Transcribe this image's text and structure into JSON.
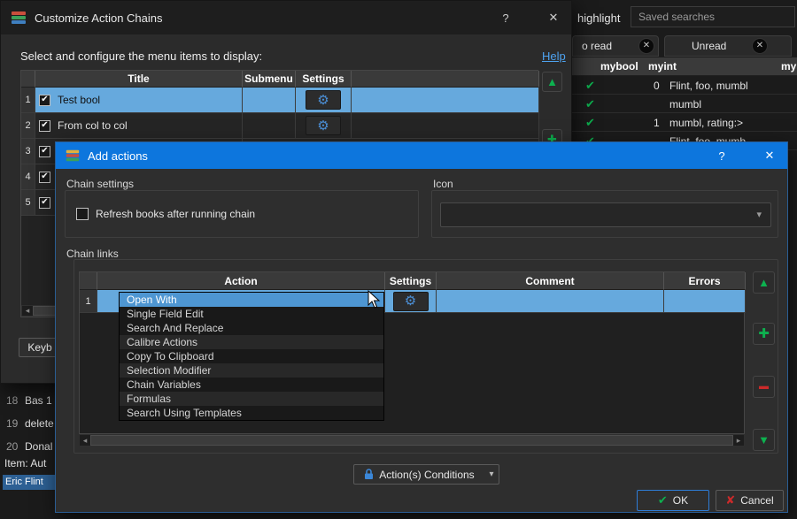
{
  "icons": {
    "check": "✔",
    "cross": "✘",
    "close": "✕",
    "help": "?",
    "up": "▲",
    "down": "▼",
    "plus": "✚",
    "minus": "▬",
    "gear": "⚙",
    "dropdown": "▾",
    "left": "◂",
    "right": "▸"
  },
  "colors": {
    "titlebar_blue": "#0d76dd",
    "selection_blue": "#66a9dd",
    "popup_highlight": "#4e96d2",
    "green": "#0db14f",
    "red": "#cc2a2a",
    "gear_blue": "#4b8fd6",
    "link_blue": "#4ea3f0",
    "item_chip_blue": "#2d6094"
  },
  "main_window": {
    "highlight_label": "highlight",
    "saved_searches_value": "Saved searches",
    "tabs": [
      {
        "label": "o read"
      },
      {
        "label": "Unread"
      }
    ],
    "book_table": {
      "columns": [
        "mybool",
        "myint",
        "my"
      ],
      "rows": [
        {
          "mybool_checked": true,
          "myint": "0",
          "my": "Flint, foo, mumbl"
        },
        {
          "mybool_checked": true,
          "myint": "",
          "my": "mumbl"
        },
        {
          "mybool_checked": true,
          "myint": "1",
          "my": "mumbl, rating:>"
        },
        {
          "mybool_checked": true,
          "myint": "",
          "my": "Flint, foo, mumb"
        }
      ]
    },
    "list_rows": [
      {
        "num": "18",
        "text": "Bas 1"
      },
      {
        "num": "19",
        "text": "delete"
      },
      {
        "num": "20",
        "text": "Donal"
      }
    ],
    "item_label": "Item: Aut",
    "item_value": "Eric Flint"
  },
  "customize_dialog": {
    "title": "Customize Action Chains",
    "instruction": "Select and configure the menu items to display:",
    "help_link": "Help",
    "columns": {
      "title": "Title",
      "submenu": "Submenu",
      "settings": "Settings"
    },
    "rows": [
      {
        "num": "1",
        "checked": true,
        "title": "Test bool",
        "selected": true
      },
      {
        "num": "2",
        "checked": true,
        "title": "From col to col",
        "selected": false
      },
      {
        "num": "3",
        "checked": true,
        "title": ""
      },
      {
        "num": "4",
        "checked": true,
        "title": ""
      },
      {
        "num": "5",
        "checked": true,
        "title": ""
      }
    ],
    "keyboard_button": "Keyb"
  },
  "add_dialog": {
    "title": "Add actions",
    "chain_settings": {
      "label": "Chain settings",
      "refresh_checkbox_label": "Refresh books after running chain",
      "refresh_checked": false
    },
    "icon_group": {
      "label": "Icon",
      "selected_value": ""
    },
    "chain_links": {
      "label": "Chain links",
      "columns": {
        "action": "Action",
        "settings": "Settings",
        "comment": "Comment",
        "errors": "Errors"
      },
      "row_num": "1",
      "dropdown_items": [
        "Open With",
        "Single Field Edit",
        "Search And Replace",
        "Calibre Actions",
        "Copy To Clipboard",
        "Selection Modifier",
        "Chain Variables",
        "Formulas",
        "Search Using Templates"
      ],
      "highlighted_item": "Open With"
    },
    "conditions_button": "Action(s) Conditions",
    "ok_button": "OK",
    "cancel_button": "Cancel"
  }
}
